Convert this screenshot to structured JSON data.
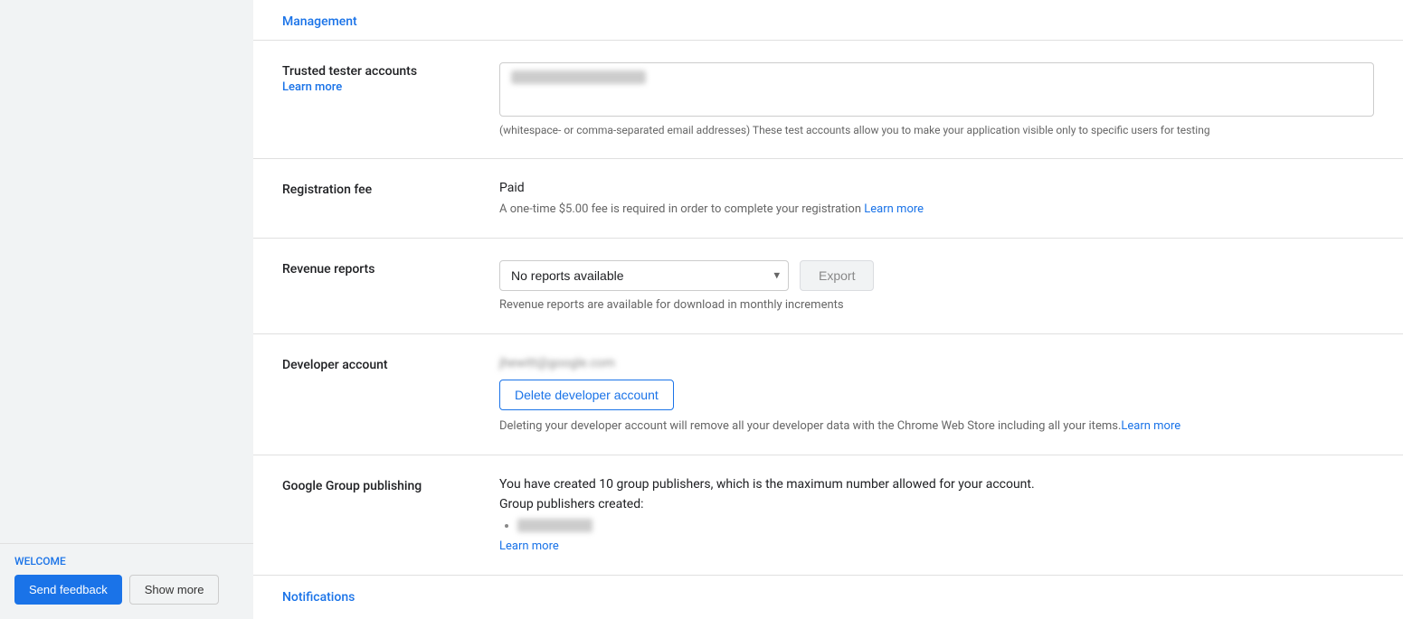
{
  "sidebar": {
    "welcome_label": "WELCOME",
    "send_feedback_label": "Send feedback",
    "show_more_label": "Show more"
  },
  "management": {
    "link_label": "Management"
  },
  "sections": {
    "trusted_tester": {
      "label": "Trusted tester accounts",
      "learn_more": "Learn more",
      "email_value": "jhewton+9 kli@gmail.com",
      "hint": "(whitespace- or comma-separated email addresses) These test accounts allow you to make your application visible only to specific users for testing"
    },
    "registration_fee": {
      "label": "Registration fee",
      "status": "Paid",
      "desc_prefix": "A one-time $5.00 fee is required in order to complete your registration",
      "learn_more": "Learn more"
    },
    "revenue_reports": {
      "label": "Revenue reports",
      "dropdown_value": "No reports available",
      "export_label": "Export",
      "hint": "Revenue reports are available for download in monthly increments"
    },
    "developer_account": {
      "label": "Developer account",
      "account_email": "jhewitt@google.com",
      "delete_button": "Delete developer account",
      "delete_hint_prefix": "Deleting your developer account will remove all your developer data with the Chrome Web Store including all your items.",
      "learn_more": "Learn more"
    },
    "google_group_publishing": {
      "label": "Google Group publishing",
      "desc": "You have created 10 group publishers, which is the maximum number allowed for your account.",
      "created_label": "Group publishers created:",
      "publisher_name": "chrome-ext-15",
      "learn_more": "Learn more"
    }
  },
  "notifications": {
    "link_label": "Notifications"
  }
}
